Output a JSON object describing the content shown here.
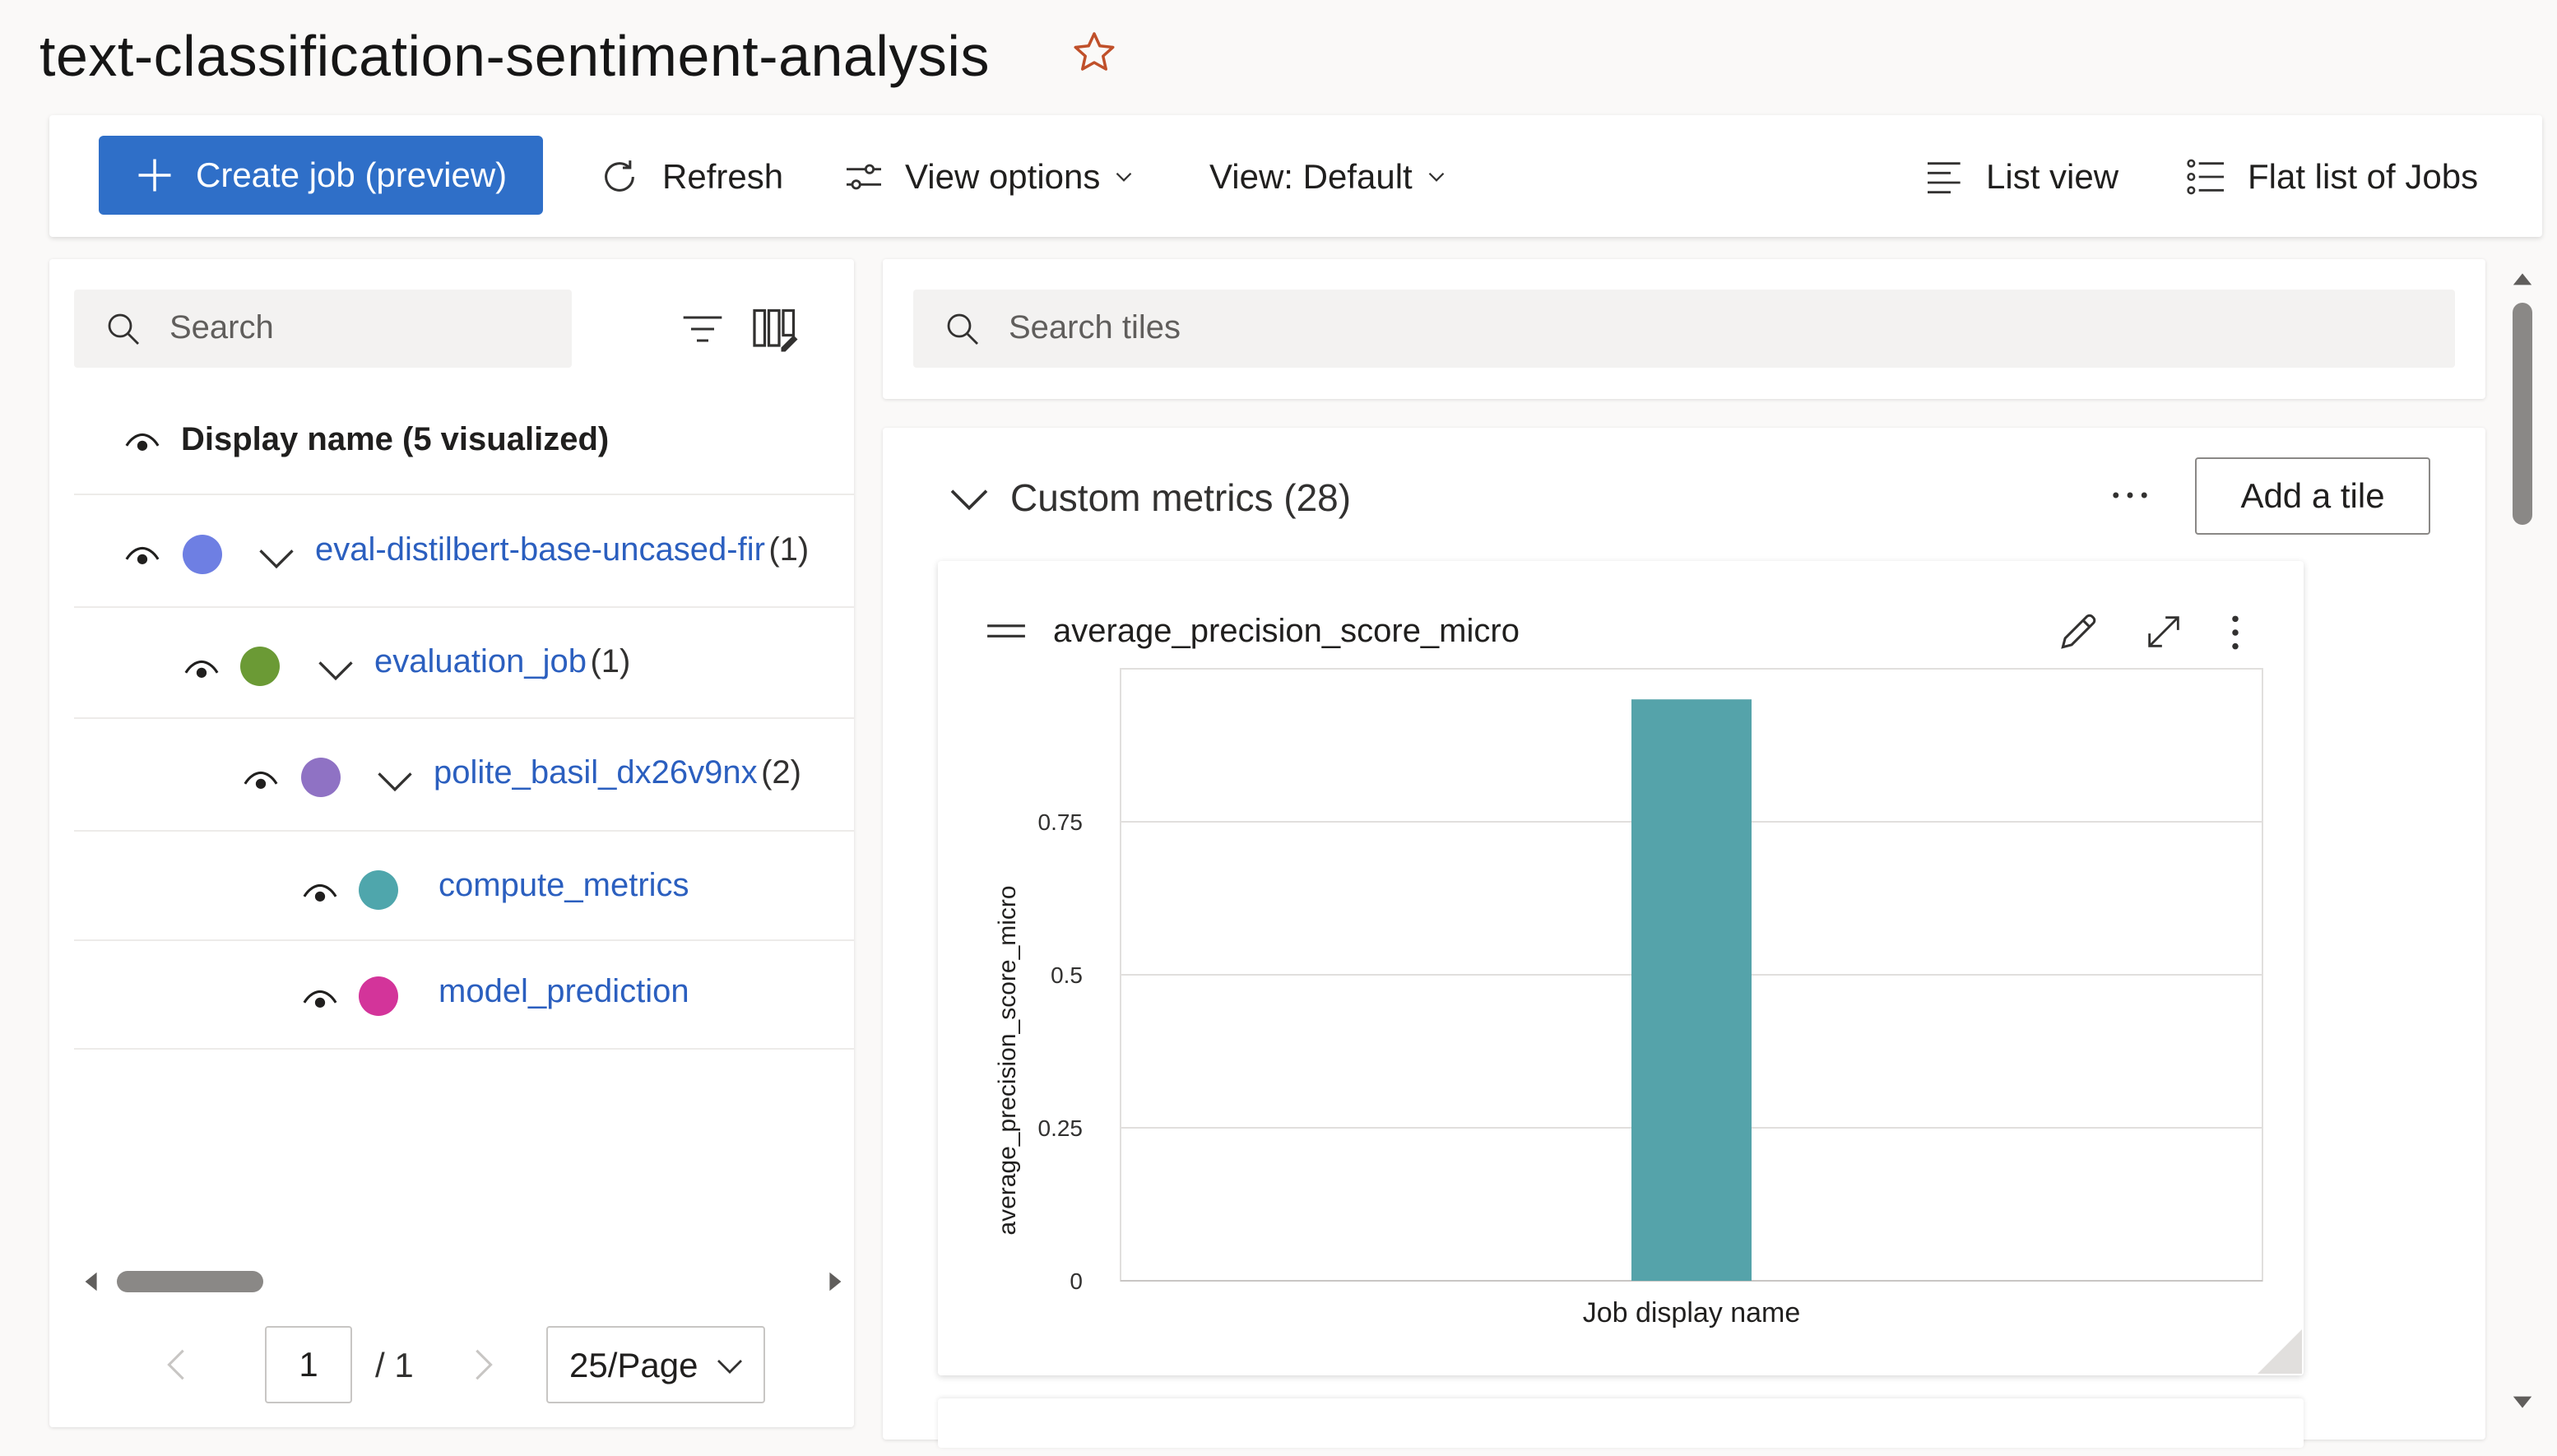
{
  "page": {
    "title": "text-classification-sentiment-analysis"
  },
  "toolbar": {
    "create_job": "Create job (preview)",
    "refresh": "Refresh",
    "view_options": "View options",
    "view_default": "View: Default",
    "list_view": "List view",
    "flat_list": "Flat list of Jobs"
  },
  "left": {
    "search_placeholder": "Search",
    "header": "Display name (5 visualized)",
    "rows": [
      {
        "label": "eval-distilbert-base-uncased-fir",
        "count": "(1)",
        "color": "#6e7fe3"
      },
      {
        "label": "evaluation_job",
        "count": "(1)",
        "color": "#6b9a35"
      },
      {
        "label": "polite_basil_dx26v9nx",
        "count": "(2)",
        "color": "#8f72c4"
      },
      {
        "label": "compute_metrics",
        "count": "",
        "color": "#4fa6ac"
      },
      {
        "label": "model_prediction",
        "count": "",
        "color": "#d3349a"
      }
    ],
    "pagination": {
      "current": "1",
      "of": "/ 1",
      "page_size": "25/Page"
    }
  },
  "right": {
    "search_placeholder": "Search tiles",
    "section_title": "Custom metrics (28)",
    "add_tile": "Add a tile",
    "tile_title": "average_precision_score_micro"
  },
  "colors": {
    "primary": "#2f6fc8",
    "link": "#2b5fbf",
    "bar": "#55a3aa",
    "star": "#c0502a"
  },
  "chart_data": {
    "type": "bar",
    "title": "average_precision_score_micro",
    "xlabel": "Job display name",
    "ylabel": "average_precision_score_micro",
    "categories": [
      ""
    ],
    "values": [
      0.95
    ],
    "ylim": [
      0,
      1.0
    ],
    "yticks": [
      0,
      0.25,
      0.5,
      0.75
    ],
    "ytick_labels": [
      "0",
      "0.25",
      "0.5",
      "0.75"
    ],
    "grid": true,
    "bar_color": "#55a3aa"
  }
}
